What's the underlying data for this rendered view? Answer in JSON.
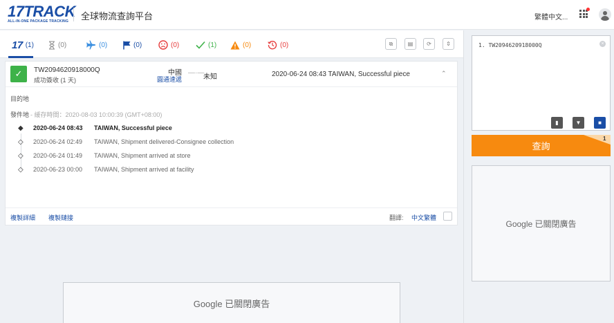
{
  "header": {
    "logo_text": "17TRACK",
    "logo_sub": "ALL-IN-ONE PACKAGE TRACKING",
    "site_title": "全球物流查詢平台",
    "language": "繁體中文...",
    "colors": {
      "brand": "#1a4ea6",
      "accent": "#f78a0f",
      "success": "#3eb249"
    }
  },
  "tabs": [
    {
      "icon": "17",
      "label": "17",
      "count": "(1)",
      "color": "#1a4ea6"
    },
    {
      "icon": "hourglass-icon",
      "count": "(0)",
      "color": "#888888"
    },
    {
      "icon": "plane-icon",
      "count": "(0)",
      "color": "#3b8fe0"
    },
    {
      "icon": "flag-icon",
      "count": "(0)",
      "color": "#1a4ea6"
    },
    {
      "icon": "sad-face-icon",
      "count": "(0)",
      "color": "#e63c3c"
    },
    {
      "icon": "check-icon",
      "count": "(1)",
      "color": "#3eb249"
    },
    {
      "icon": "warning-icon",
      "count": "(0)",
      "color": "#f78a0f"
    },
    {
      "icon": "clock-icon",
      "count": "(0)",
      "color": "#e63c3c"
    }
  ],
  "shipment": {
    "tracking_number": "TW2094620918000Q",
    "status": "成功簽收 (1 天)",
    "origin_country": "中國",
    "origin_carrier": "圓通速遞",
    "dest_country": "未知",
    "latest_event": "2020-06-24 08:43 TAIWAN, Successful piece",
    "destination_label": "目的地",
    "origin_label": "發件地",
    "cache_time": "- 緩存時間：2020-08-03 10:00:39 (GMT+08:00)",
    "events": [
      {
        "time": "2020-06-24 08:43",
        "desc": "TAIWAN, Successful piece"
      },
      {
        "time": "2020-06-24 02:49",
        "desc": "TAIWAN, Shipment delivered-Consignee collection"
      },
      {
        "time": "2020-06-24 01:49",
        "desc": "TAIWAN, Shipment arrived at store"
      },
      {
        "time": "2020-06-23 00:00",
        "desc": "TAIWAN, Shipment arrived at facility"
      }
    ]
  },
  "footer": {
    "copy_details": "複製詳細",
    "copy_link": "複製鏈接",
    "translate_label": "翻譯:",
    "translate_lang": "中文繁體"
  },
  "ads": {
    "bottom": "Google 已關閉廣告",
    "right": "Google 已關閉廣告"
  },
  "query": {
    "input_value": "1. TW2094620918000Q",
    "button_label": "查詢",
    "count_badge": "1"
  }
}
